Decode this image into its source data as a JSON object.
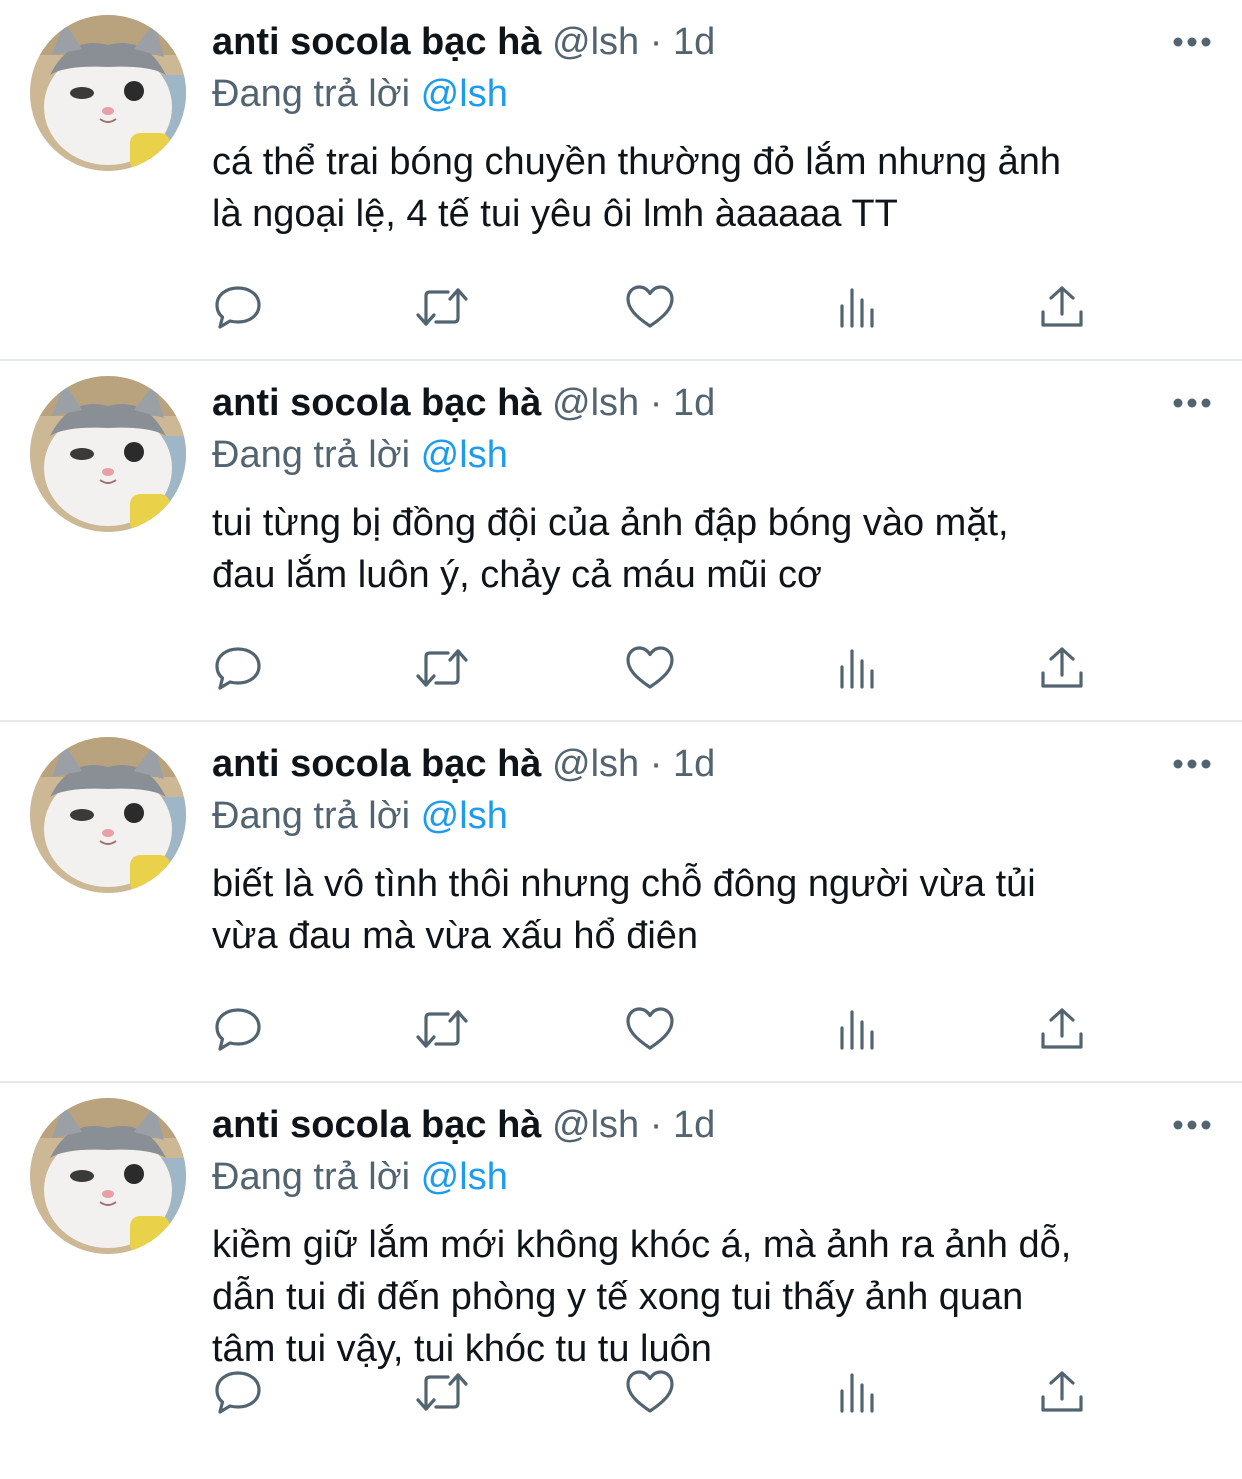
{
  "tweets": [
    {
      "name": "anti socola bạc hà",
      "handle": "@lsh",
      "dot": "·",
      "time": "1d",
      "reply_prefix": "Đang trả lời",
      "reply_mention": "@lsh",
      "text": "cá thể trai bóng chuyền thường đỏ lắm nhưng ảnh\nlà ngoại lệ, 4 tế tui yêu ôi lmh àaaaaa TT"
    },
    {
      "name": "anti socola bạc hà",
      "handle": "@lsh",
      "dot": "·",
      "time": "1d",
      "reply_prefix": "Đang trả lời",
      "reply_mention": "@lsh",
      "text": "tui từng bị đồng đội của ảnh đập bóng vào mặt,\nđau lắm luôn ý, chảy cả máu mũi cơ"
    },
    {
      "name": "anti socola bạc hà",
      "handle": "@lsh",
      "dot": "·",
      "time": "1d",
      "reply_prefix": "Đang trả lời",
      "reply_mention": "@lsh",
      "text": "biết là vô tình thôi nhưng chỗ đông người vừa tủi\nvừa đau mà vừa xấu hổ điên"
    },
    {
      "name": "anti socola bạc hà",
      "handle": "@lsh",
      "dot": "·",
      "time": "1d",
      "reply_prefix": "Đang trả lời",
      "reply_mention": "@lsh",
      "text": "kiềm giữ lắm mới không khóc á, mà ảnh ra ảnh dỗ,\ndẫn tui đi đến phòng y tế xong tui thấy ảnh quan\ntâm tui vậy, tui khóc tu tu luôn"
    }
  ],
  "colors": {
    "text": "#0f1419",
    "secondary": "#536471",
    "accent": "#1d9bf0",
    "divider": "#e6e9ec"
  },
  "icons": [
    "reply-icon",
    "retweet-icon",
    "like-icon",
    "views-icon",
    "share-icon",
    "more-icon"
  ]
}
